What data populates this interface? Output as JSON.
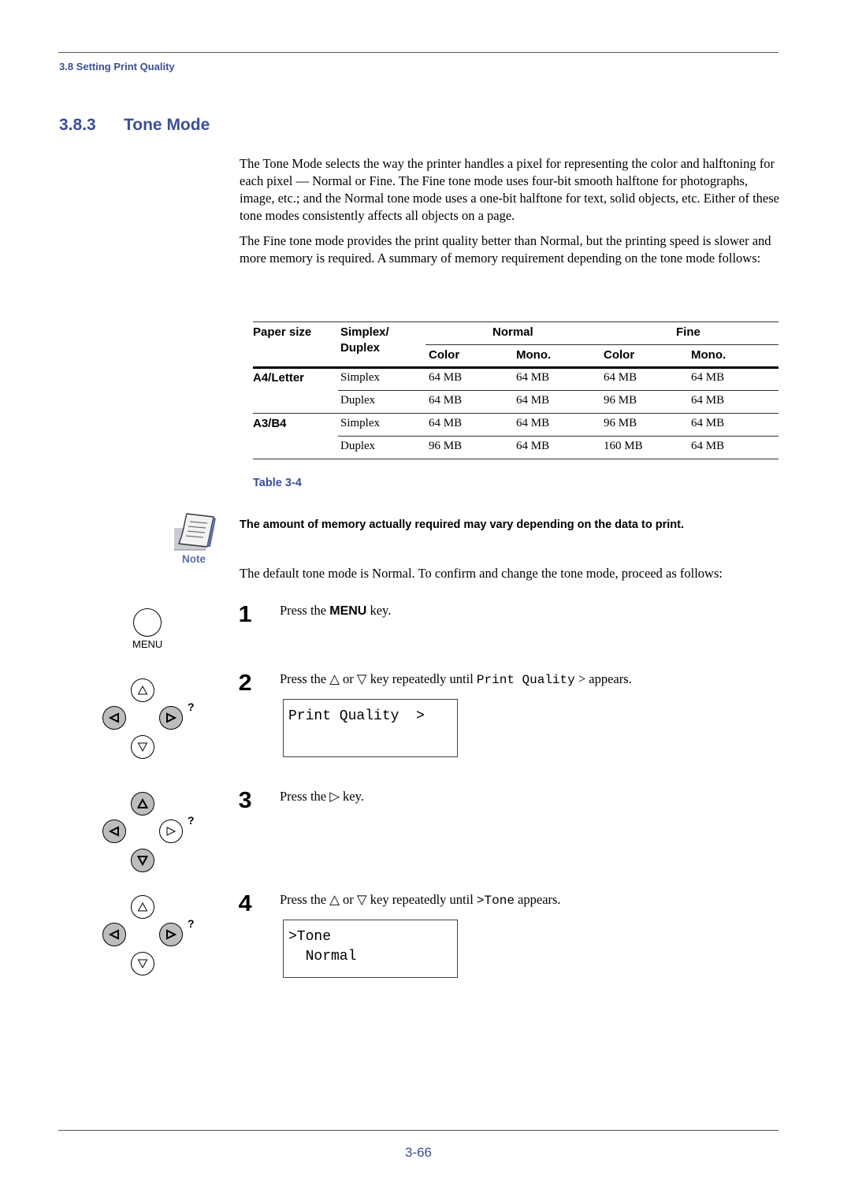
{
  "header": {
    "section": "3.8 Setting Print Quality"
  },
  "title": {
    "number": "3.8.3",
    "text": "Tone Mode"
  },
  "paragraphs": {
    "intro": "The Tone Mode selects the way the printer handles a pixel for representing the color and halftoning for each pixel — Normal or Fine. The Fine tone mode uses four-bit smooth halftone for photographs, image, etc.; and the Normal tone mode uses a one-bit halftone for text, solid objects, etc. Either of these tone modes consistently affects all objects on a page.",
    "fine": "The Fine tone mode provides the print quality better than Normal, but the printing speed is slower and more memory is required. A summary of memory requirement depending on the tone mode follows:",
    "default": "The default tone mode is Normal. To confirm and change the tone mode, proceed as follows:"
  },
  "table": {
    "headers": {
      "paper_size": "Paper size",
      "simplex_duplex_1": "Simplex/",
      "simplex_duplex_2": "Duplex",
      "normal": "Normal",
      "fine": "Fine",
      "color": "Color",
      "mono": "Mono."
    },
    "rows": [
      {
        "paper": "A4/Letter",
        "mode": "Simplex",
        "normal_color": "64 MB",
        "normal_mono": "64 MB",
        "fine_color": "64 MB",
        "fine_mono": "64 MB"
      },
      {
        "paper": "",
        "mode": "Duplex",
        "normal_color": "64 MB",
        "normal_mono": "64 MB",
        "fine_color": "96 MB",
        "fine_mono": "64 MB"
      },
      {
        "paper": "A3/B4",
        "mode": "Simplex",
        "normal_color": "64 MB",
        "normal_mono": "64 MB",
        "fine_color": "96 MB",
        "fine_mono": "64 MB"
      },
      {
        "paper": "",
        "mode": "Duplex",
        "normal_color": "96 MB",
        "normal_mono": "64 MB",
        "fine_color": "160 MB",
        "fine_mono": "64 MB"
      }
    ],
    "caption": "Table 3-4"
  },
  "note": {
    "label": "Note",
    "text": "The amount of memory actually required may vary depending on the data to print."
  },
  "steps": [
    {
      "number": "1",
      "pre": "Press the ",
      "key": "MENU",
      "post": " key.",
      "key_label": "MENU"
    },
    {
      "number": "2",
      "pre": "Press the △ or ▽ key repeatedly until ",
      "mono": "Print Quality",
      "post": " > appears.",
      "lcd": [
        "Print Quality  >",
        ""
      ]
    },
    {
      "number": "3",
      "pre": "Press the ▷ key."
    },
    {
      "number": "4",
      "pre": "Press the △ or ▽ key repeatedly until ",
      "mono": ">Tone",
      "post": " appears.",
      "lcd": [
        ">Tone",
        "  Normal"
      ]
    }
  ],
  "keypad": {
    "help_glyph": "?"
  },
  "colors": {
    "accent": "#3b4f95",
    "note_label": "#5a6fa8",
    "active_key": "#bdbdbd"
  },
  "footer": {
    "page_number": "3-66"
  }
}
